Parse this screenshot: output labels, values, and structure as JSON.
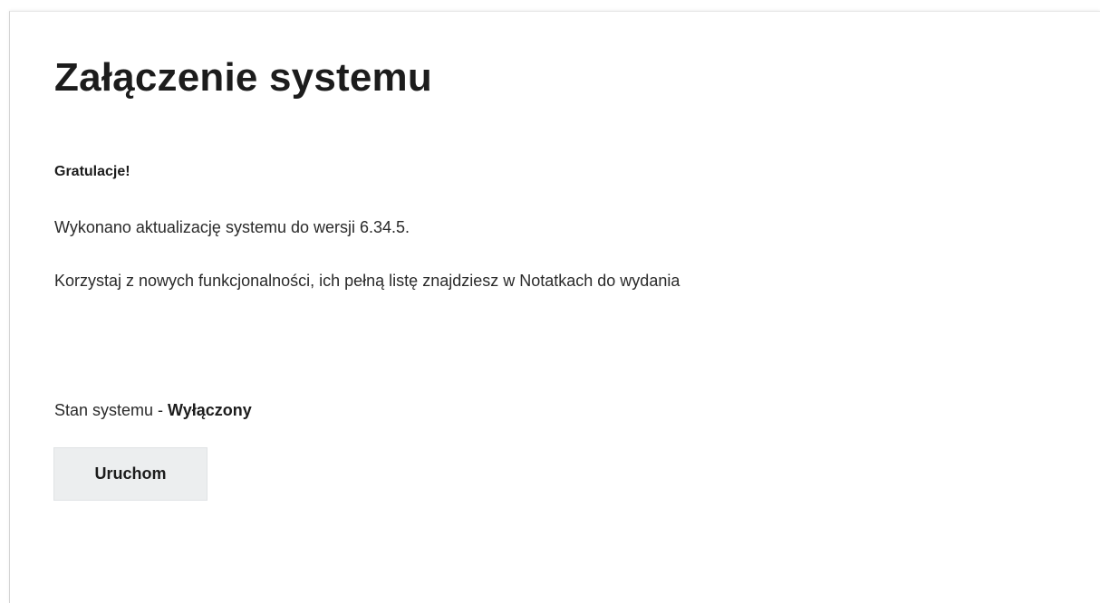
{
  "page": {
    "title": "Załączenie systemu",
    "congrats": "Gratulacje!",
    "update_message": "Wykonano aktualizację systemu do wersji 6.34.5.",
    "release_notes_message": "Korzystaj z nowych funkcjonalności, ich pełną listę znajdziesz w Notatkach do wydania"
  },
  "status": {
    "label": "Stan systemu - ",
    "value": "Wyłączony"
  },
  "actions": {
    "start_label": "Uruchom"
  }
}
